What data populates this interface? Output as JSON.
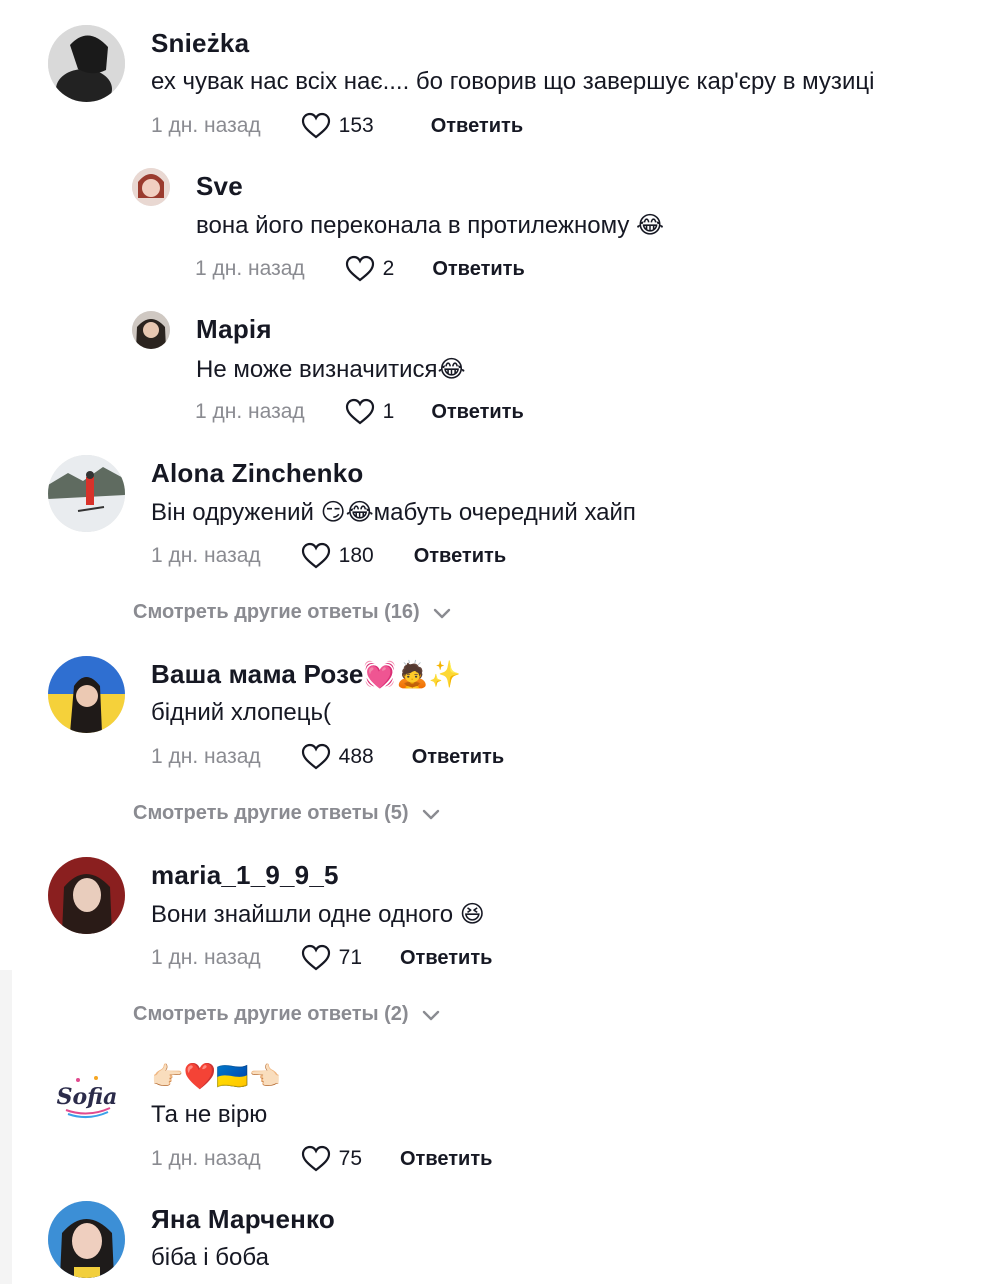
{
  "comments": [
    {
      "author": "Snieżka",
      "text": "ех чувак нас всіх нає.... бо говорив що завершує кар'єру в музиці",
      "time": "1 дн. назад",
      "likes": "153",
      "reply_label": "Ответить"
    },
    {
      "author": "Sve",
      "text": "вона його переконала в протилежному 😂",
      "time": "1 дн. назад",
      "likes": "2",
      "reply_label": "Ответить"
    },
    {
      "author": "Марія",
      "text": "Не може визначитися😂",
      "time": "1 дн. назад",
      "likes": "1",
      "reply_label": "Ответить"
    },
    {
      "author": "Alona Zinchenko",
      "text": "Він одружений 😏😂мабуть очередний хайп",
      "time": "1 дн. назад",
      "likes": "180",
      "reply_label": "Ответить"
    },
    {
      "author": "Ваша мама Розе💓🙇✨",
      "text": "бідний хлопець(",
      "time": "1 дн. назад",
      "likes": "488",
      "reply_label": "Ответить"
    },
    {
      "author": "maria_1_9_9_5",
      "text": "Вони знайшли одне одного 😆",
      "time": "1 дн. назад",
      "likes": "71",
      "reply_label": "Ответить"
    },
    {
      "author": "👉🏻❤️🇺🇦👈🏻",
      "text": "Та не вірю",
      "time": "1 дн. назад",
      "likes": "75",
      "reply_label": "Ответить",
      "avatar_text": "Sofia"
    },
    {
      "author": "Яна Марченко",
      "text": "біба і боба"
    }
  ],
  "more_replies": [
    "Смотреть другие ответы (16)",
    "Смотреть другие ответы (5)",
    "Смотреть другие ответы (2)"
  ],
  "icons": {
    "like": "heart-outline-icon",
    "expand": "chevron-down-icon"
  },
  "colors": {
    "text": "#161823",
    "muted": "#8a8b91"
  }
}
